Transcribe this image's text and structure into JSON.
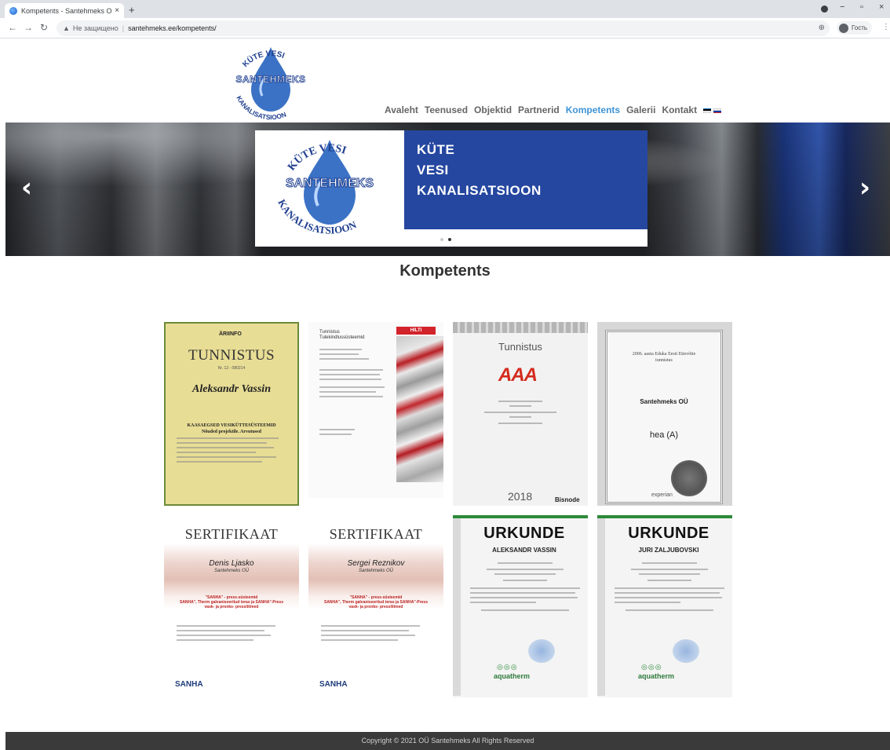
{
  "browser": {
    "tab_title": "Kompetents - Santehmeks OÜ",
    "tab_close": "×",
    "new_tab": "+",
    "security_label": "Не защищено",
    "url": "santehmeks.ee/kompetents/",
    "profile_label": "Гость",
    "window_controls": [
      "−",
      "▫",
      "×"
    ]
  },
  "site": {
    "logo_text": "SANTEHMEKS",
    "logo_arc_top": "KÜTE  VESI",
    "logo_arc_bottom": "KANALISATSIOON",
    "nav": [
      {
        "label": "Avaleht",
        "active": false
      },
      {
        "label": "Teenused",
        "active": false
      },
      {
        "label": "Objektid",
        "active": false
      },
      {
        "label": "Partnerid",
        "active": false
      },
      {
        "label": "Kompetents",
        "active": true
      },
      {
        "label": "Galerii",
        "active": false
      },
      {
        "label": "Kontakt",
        "active": false
      }
    ],
    "accent_color": "#3f94d6"
  },
  "hero": {
    "lines": [
      "KÜTE",
      "VESI",
      "KANALISATSIOON"
    ],
    "prev_arrow": "‹",
    "next_arrow": "›",
    "slide_count": 2,
    "active_slide": 2
  },
  "page": {
    "title": "Kompetents"
  },
  "certificates": {
    "c1": {
      "org": "ÄRIINFO",
      "title": "TUNNISTUS",
      "number": "Nr. 12 - 080214",
      "name": "Aleksandr Vassin",
      "subject_1": "KAASAEGSED VESIKÜTTESÜSTEEMID",
      "subject_2": "Nõuded projektile. Arvutused"
    },
    "c2": {
      "title_1": "Tunnistus",
      "title_2": "Tulekindlussüsteemid",
      "brand": "HILTI"
    },
    "c3": {
      "title": "Tunnistus",
      "rating": "AAA",
      "year": "2018",
      "brand": "Bisnode"
    },
    "c4": {
      "header_1": "2006. aasta Eduka Eesti Ettevõtte",
      "header_2": "tunnistus",
      "company": "Santehmeks OÜ",
      "grade": "hea (A)",
      "brand": "experian"
    },
    "c5": {
      "title": "SERTIFIKAAT",
      "name": "Denis Ljasko",
      "company": "Santehmeks OÜ",
      "text_1": "\"SANHA\" - press-süsteemid",
      "text_2": "SANHA\", Therm galvaniseeritud teras ja SANHA\"-Press",
      "text_3": "vask- ja pronks- pressliitmed",
      "brand": "SANHA"
    },
    "c6": {
      "title": "SERTIFIKAAT",
      "name": "Sergei Reznikov",
      "company": "Santehmeks OÜ",
      "text_1": "\"SANHA\" - press-süsteemid",
      "text_2": "SANHA\", Therm galvaniseeritud teras ja SANHA\"-Press",
      "text_3": "vask- ja pronks- pressliitmed",
      "brand": "SANHA"
    },
    "c7": {
      "title": "URKUNDE",
      "name": "ALEKSANDR VASSIN",
      "brand": "aquatherm",
      "logo": "◎◎◎"
    },
    "c8": {
      "title": "URKUNDE",
      "name": "JURI ZALJUBOVSKI",
      "brand": "aquatherm",
      "logo": "◎◎◎"
    }
  },
  "footer": {
    "copyright": "Copyright © 2021 OÜ Santehmeks All Rights Reserved"
  }
}
